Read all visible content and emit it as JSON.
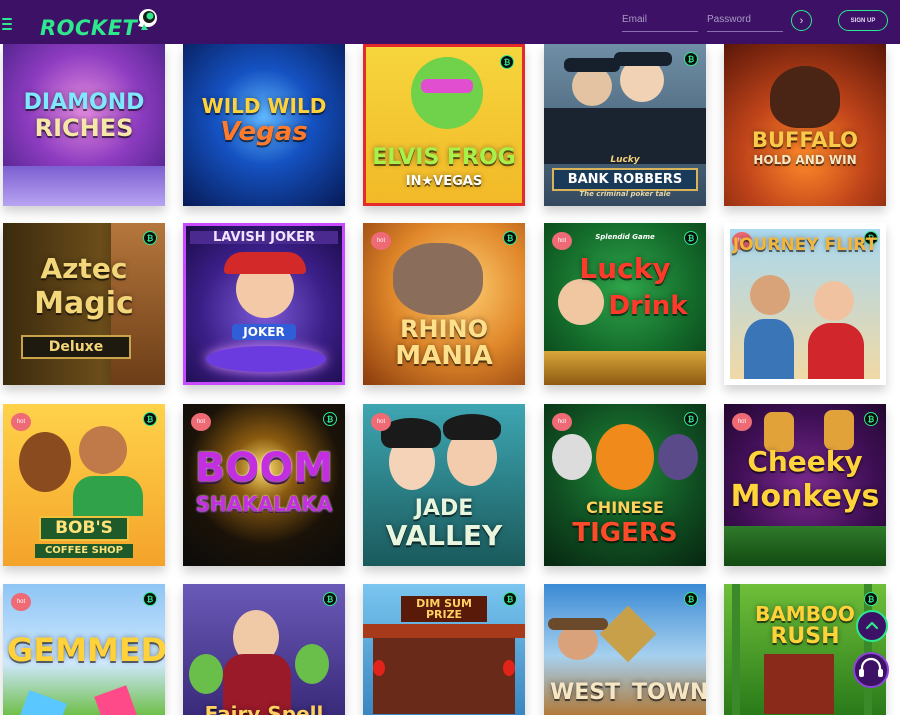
{
  "header": {
    "logo_text": "ROCKET",
    "email_placeholder": "Email",
    "password_placeholder": "Password",
    "go_icon": "›",
    "signup_label": "SIGN UP"
  },
  "badges": {
    "hot": "hot",
    "crypto": "₿"
  },
  "games": [
    {
      "lines": [
        "DIAMOND",
        "RICHES"
      ]
    },
    {
      "lines": [
        "WILD WILD",
        "Vegas"
      ]
    },
    {
      "lines": [
        "ELVIS FROG",
        "IN★VEGAS"
      ]
    },
    {
      "lines": [
        "Lucky",
        "BANK ROBBERS",
        "The criminal poker tale"
      ]
    },
    {
      "lines": [
        "BUFFALO",
        "HOLD AND WIN"
      ]
    },
    {
      "lines": [
        "Aztec",
        "Magic",
        "Deluxe"
      ]
    },
    {
      "lines": [
        "LAVISH JOKER",
        "JOKER"
      ]
    },
    {
      "lines": [
        "RHINO",
        "MANIA"
      ]
    },
    {
      "lines": [
        "Splendid Game",
        "Lucky",
        "Drink"
      ]
    },
    {
      "lines": [
        "JOURNEY FLIRT"
      ]
    },
    {
      "lines": [
        "BOB'S",
        "COFFEE SHOP"
      ]
    },
    {
      "lines": [
        "BOOM",
        "SHAKALAKA"
      ]
    },
    {
      "lines": [
        "JADE",
        "VALLEY"
      ]
    },
    {
      "lines": [
        "CHINESE",
        "TIGERS"
      ]
    },
    {
      "lines": [
        "Cheeky",
        "Monkeys"
      ]
    },
    {
      "lines": [
        "GEMMED!"
      ]
    },
    {
      "lines": [
        "Fairy Spell"
      ]
    },
    {
      "lines": [
        "DIM SUM",
        "PRIZE"
      ]
    },
    {
      "lines": [
        "WEST",
        "TOWN"
      ]
    },
    {
      "lines": [
        "BAMBOO",
        "RUSH"
      ]
    }
  ],
  "colors": {
    "header_bg": "#3d1166",
    "accent": "#2ee88e",
    "hot_badge": "#ee6a75"
  },
  "icons": {
    "menu": "hamburger-menu-icon",
    "scroll_up": "chevron-up-icon",
    "support": "headset-support-icon"
  }
}
